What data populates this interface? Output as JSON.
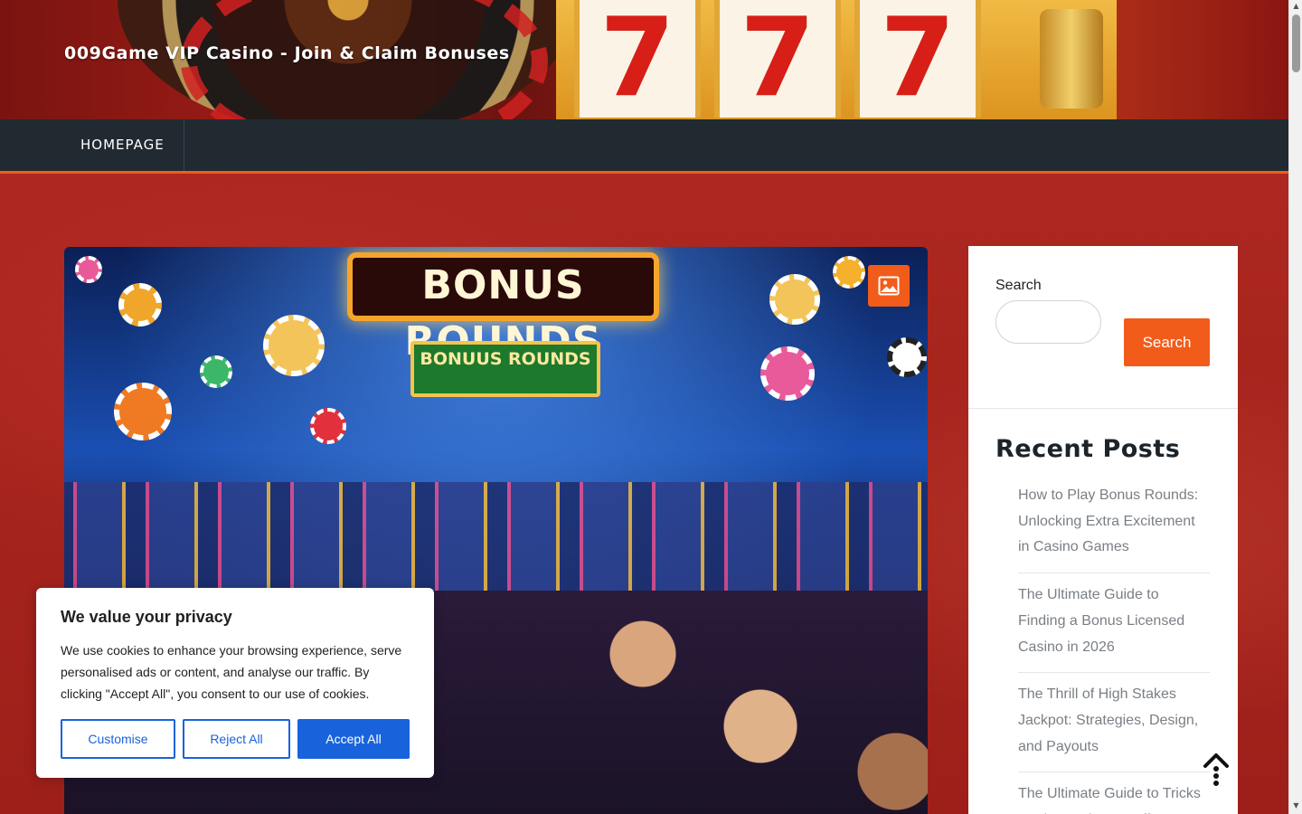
{
  "header": {
    "site_title": "009Game VIP Casino - Join & Claim Bonuses",
    "banner_reels": [
      "7",
      "7",
      "7"
    ]
  },
  "nav": {
    "items": [
      {
        "label": "HOMEPAGE"
      }
    ]
  },
  "featured": {
    "sign_text": "BONUS ROUNDS",
    "sub_sign_text": "BONUUS ROUNDS",
    "icon": "image-icon"
  },
  "sidebar": {
    "search_label": "Search",
    "search_value": "",
    "search_button": "Search",
    "recent_title": "Recent Posts",
    "recent_posts": [
      "How to Play Bonus Rounds: Unlocking Extra Excitement in Casino Games",
      "The Ultimate Guide to Finding a Bonus Licensed Casino in 2026",
      "The Thrill of High Stakes Jackpot: Strategies, Design, and Payouts",
      "The Ultimate Guide to Tricks Casino Welcome Offer:"
    ]
  },
  "cookie": {
    "title": "We value your privacy",
    "text": "We use cookies to enhance your browsing experience, serve personalised ads or content, and analyse our traffic. By clicking \"Accept All\", you consent to our use of cookies.",
    "customise": "Customise",
    "reject": "Reject All",
    "accept": "Accept All"
  },
  "colors": {
    "accent": "#f25c1b",
    "nav_bg": "#212a31",
    "cookie_primary": "#1863dc",
    "page_bg": "#a8231d"
  }
}
